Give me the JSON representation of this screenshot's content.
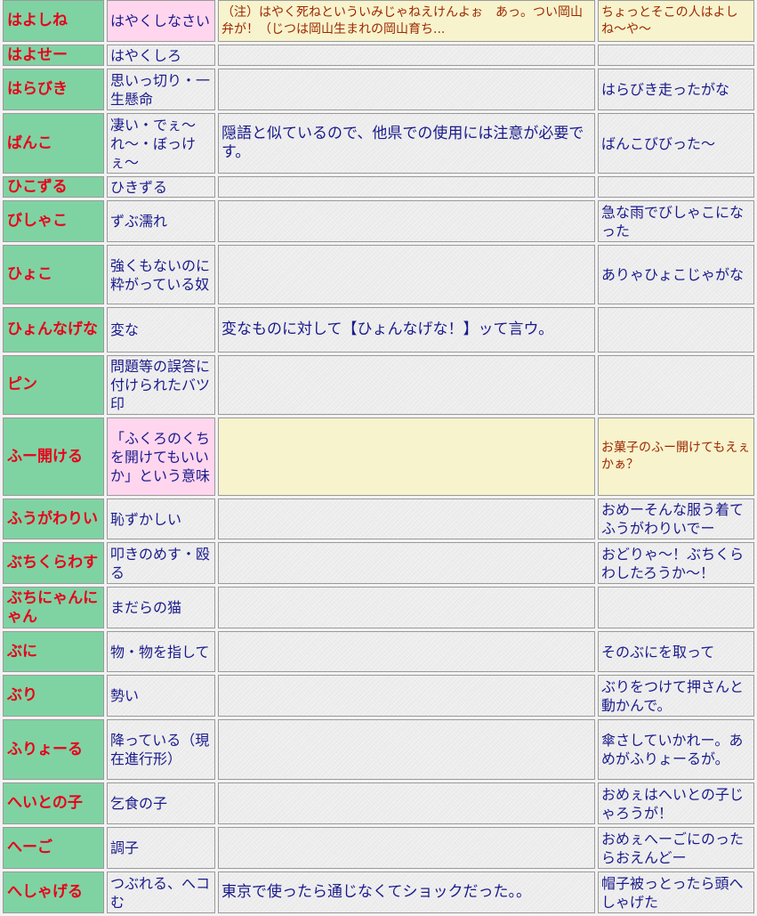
{
  "rows": [
    {
      "word": "はよしね",
      "meaning": "はやくしなさい",
      "note": "（注）はやく死ねといういみじゃねえけんよぉ　あっ。つい岡山弁が！（じつは岡山生まれの岡山育ち...",
      "example": "ちょっとそこの人はよしね〜や〜"
    },
    {
      "word": "はよせー",
      "meaning": "はやくしろ",
      "note": "",
      "example": ""
    },
    {
      "word": "はらびき",
      "meaning": "思いっ切り・一生懸命",
      "note": "",
      "example": "はらびき走ったがな"
    },
    {
      "word": "ばんこ",
      "meaning": "凄い・でぇ〜れ〜・ぼっけぇ〜",
      "note": "隠語と似ているので、他県での使用には注意が必要です。",
      "example": "ばんこびびった〜"
    },
    {
      "word": "ひこずる",
      "meaning": "ひきずる",
      "note": "",
      "example": ""
    },
    {
      "word": "びしゃこ",
      "meaning": "ずぶ濡れ",
      "note": "",
      "example": "急な雨でびしゃこになった"
    },
    {
      "word": "ひょこ",
      "meaning": "強くもないのに粋がっている奴",
      "note": "",
      "example": "ありゃひょこじゃがな"
    },
    {
      "word": "ひょんなげな",
      "meaning": "変な",
      "note": "変なものに対して【ひょんなげな！】ッて言ウ。",
      "example": ""
    },
    {
      "word": "ピン",
      "meaning": "問題等の誤答に付けられたバツ印",
      "note": "",
      "example": ""
    },
    {
      "word": "ふー開ける",
      "meaning": "「ふくろのくちを開けてもいいか」という意味",
      "note": "",
      "example": "お菓子のふー開けてもえぇかぁ？"
    },
    {
      "word": "ふうがわりい",
      "meaning": "恥ずかしい",
      "note": "",
      "example": "おめーそんな服う着てふうがわりいでー"
    },
    {
      "word": "ぶちくらわす",
      "meaning": "叩きのめす・殴る",
      "note": "",
      "example": "おどりゃ〜！ぶちくらわしたろうか〜！"
    },
    {
      "word": "ぶちにゃんにゃん",
      "meaning": "まだらの猫",
      "note": "",
      "example": ""
    },
    {
      "word": "ぶに",
      "meaning": "物・物を指して",
      "note": "",
      "example": "そのぶにを取って"
    },
    {
      "word": "ぶり",
      "meaning": "勢い",
      "note": "",
      "example": "ぶりをつけて押さんと動かんで。"
    },
    {
      "word": "ふりょーる",
      "meaning": "降っている（現在進行形）",
      "note": "",
      "example": "傘さしていかれー。あめがふりょーるが。"
    },
    {
      "word": "へいとの子",
      "meaning": "乞食の子",
      "note": "",
      "example": "おめぇはへいとの子じゃろうが！"
    },
    {
      "word": "へーご",
      "meaning": "調子",
      "note": "",
      "example": "おめぇへーごにのったらおえんどー"
    },
    {
      "word": "へしゃげる",
      "meaning": "つぶれる、へコむ",
      "note": "東京で使ったら通じなくてショックだった。。",
      "example": "帽子被っとったら頭へしゃげた"
    }
  ]
}
